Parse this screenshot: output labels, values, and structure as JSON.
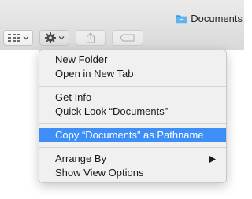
{
  "window": {
    "title": "Documents",
    "title_icon": "folder-icon"
  },
  "toolbar": {
    "buttons": [
      {
        "name": "view-options",
        "icon": "icon-grid-icon"
      },
      {
        "name": "action",
        "icon": "gear-icon"
      },
      {
        "name": "share",
        "icon": "share-icon"
      },
      {
        "name": "tags",
        "icon": "tag-icon"
      }
    ]
  },
  "menu": {
    "items": [
      {
        "label": "New Folder"
      },
      {
        "label": "Open in New Tab"
      },
      {
        "label": "Get Info"
      },
      {
        "label": "Quick Look “Documents”"
      },
      {
        "label": "Copy “Documents” as Pathname",
        "highlighted": true
      },
      {
        "label": "Arrange By",
        "submenu": true
      },
      {
        "label": "Show View Options"
      }
    ]
  },
  "colors": {
    "highlight": "#3d8ff7",
    "folder": "#3a9be8"
  }
}
